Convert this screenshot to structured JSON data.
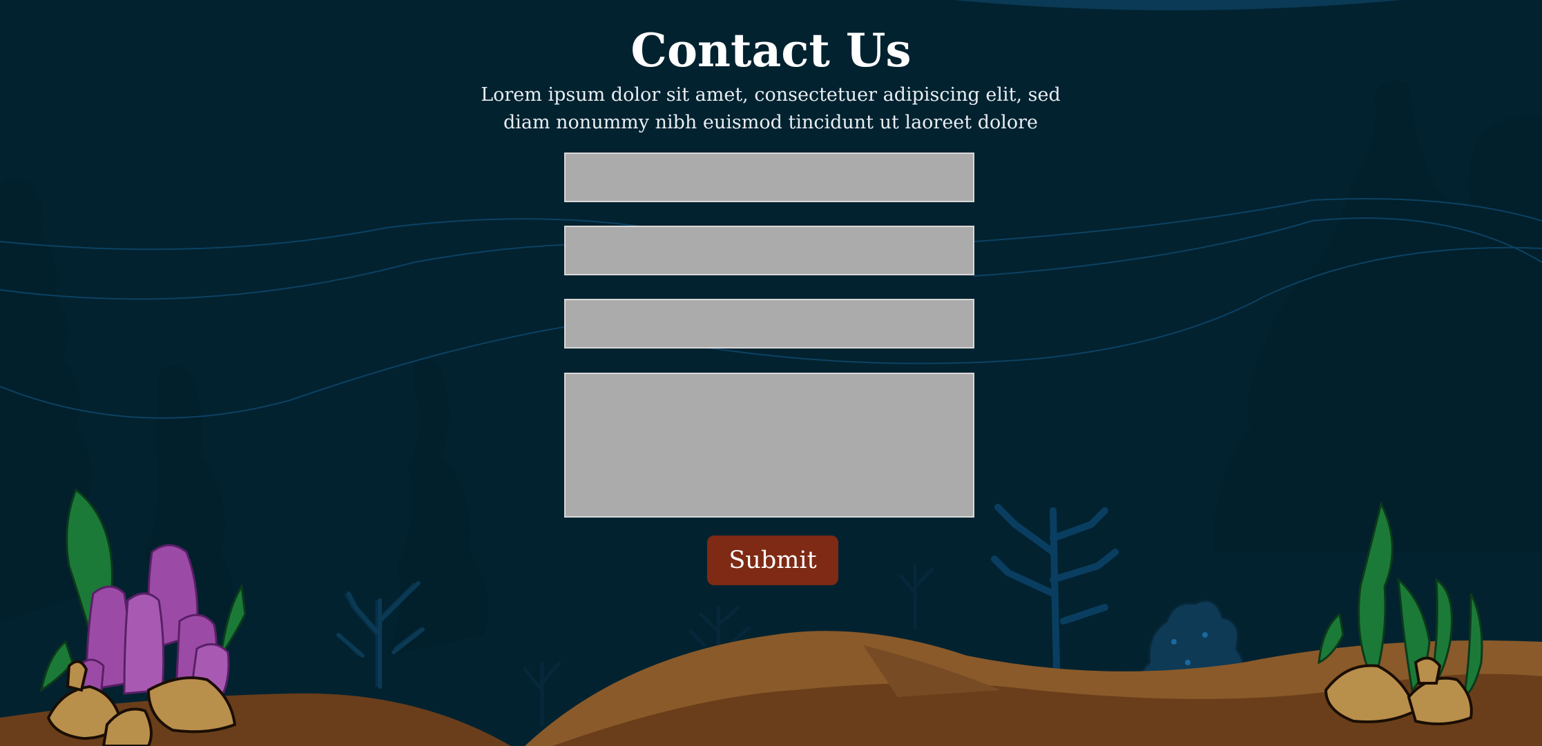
{
  "page": {
    "title": "Contact Us",
    "subtitle": "Lorem ipsum dolor sit amet, consectetuer adipiscing elit, sed diam nonummy nibh euismod tincidunt ut laoreet dolore"
  },
  "form": {
    "fields": [
      {
        "value": "",
        "placeholder": ""
      },
      {
        "value": "",
        "placeholder": ""
      },
      {
        "value": "",
        "placeholder": ""
      },
      {
        "value": "",
        "placeholder": ""
      }
    ],
    "submit_label": "Submit"
  },
  "colors": {
    "background": "#022230",
    "field_fill": "#ababab",
    "submit_button": "#7e2a14",
    "sand": "#774b23",
    "coral_blue": "#0a3f63",
    "seaweed_green": "#1c7a38",
    "sponge_purple": "#9b4ba6"
  },
  "icons": [
    "underwater-scene",
    "seaweed-icon",
    "coral-icon",
    "sponge-coral-icon",
    "rock-icon"
  ]
}
